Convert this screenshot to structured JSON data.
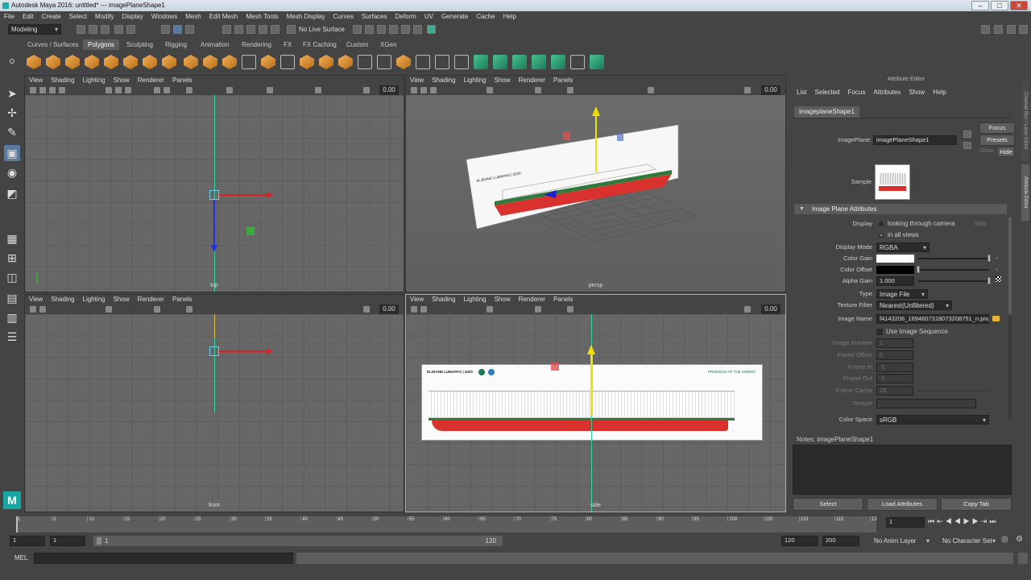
{
  "window": {
    "title": "Autodesk Maya 2016: untitled*   ---   imagePlaneShape1",
    "min": "–",
    "max": "□",
    "close": "✕"
  },
  "menubar": [
    "File",
    "Edit",
    "Create",
    "Select",
    "Modify",
    "Display",
    "Windows",
    "Mesh",
    "Edit Mesh",
    "Mesh Tools",
    "Mesh Display",
    "Curves",
    "Surfaces",
    "Deform",
    "UV",
    "Generate",
    "Cache",
    "Help"
  ],
  "statusline": {
    "menuset": "Modeling",
    "live_surface": "No Live Surface"
  },
  "shelf_tabs": [
    "Curves / Surfaces",
    "Polygons",
    "Sculpting",
    "Rigging",
    "Animation",
    "Rendering",
    "FX",
    "FX Caching",
    "Custom",
    "XGen"
  ],
  "shelf_active": "Polygons",
  "viewport_menu": [
    "View",
    "Shading",
    "Lighting",
    "Show",
    "Renderer",
    "Panels"
  ],
  "viewports": {
    "top": {
      "label": "top",
      "num": "0.00"
    },
    "persp": {
      "label": "persp",
      "num": "0.00"
    },
    "front": {
      "label": "front",
      "num": "0.00"
    },
    "side": {
      "label": "side",
      "num": "0.00"
    }
  },
  "image_plane_text": {
    "brand": "M.JEANE LUMAPAS | 2020",
    "ship_name": "PRINCESS OF THE ORIENT"
  },
  "attribute_editor": {
    "header": "Attribute Editor",
    "menu": [
      "List",
      "Selected",
      "Focus",
      "Attributes",
      "Show",
      "Help"
    ],
    "tab": "imageplaneShape1",
    "node_label": "imagePlane:",
    "node_value": "imagePlaneShape1",
    "focus": "Focus",
    "presets": "Presets",
    "show": "Show",
    "hide": "Hide",
    "sample_label": "Sample",
    "section": "Image Plane Attributes",
    "display_label": "Display",
    "display_opt1": "looking through camera",
    "display_opt1_extra": "side",
    "display_opt2": "in all views",
    "display_mode_label": "Display Mode",
    "display_mode": "RGBA",
    "color_gain_label": "Color Gain",
    "color_gain": "#ffffff",
    "color_offset_label": "Color Offset",
    "color_offset": "#000000",
    "alpha_gain_label": "Alpha Gain",
    "alpha_gain": "1.000",
    "type_label": "Type",
    "type": "Image File",
    "texture_filter_label": "Texture Filter",
    "texture_filter": "Nearest(Unfiltered)",
    "image_name_label": "Image Name",
    "image_name": "f4143206_1694607318073208751_n.png",
    "use_seq": "Use Image Sequence",
    "image_number_label": "Image Number",
    "image_number": "1",
    "frame_offset_label": "Frame Offset",
    "frame_offset": "0",
    "frame_in_label": "Frame In",
    "frame_in": "-1",
    "frame_out_label": "Frame Out",
    "frame_out": "-1",
    "frame_cache_label": "Frame Cache",
    "frame_cache": "25",
    "texture_label": "Texture",
    "color_space_label": "Color Space",
    "color_space": "sRGB",
    "notes": "Notes:  imagePlaneShape1",
    "btn_select": "Select",
    "btn_load": "Load Attributes",
    "btn_copy": "Copy Tab",
    "side_tabs": [
      "Channel Box / Layer Editor",
      "Attribute Editor"
    ]
  },
  "timeslider": {
    "ticks": [
      "1",
      "5",
      "10",
      "15",
      "20",
      "25",
      "30",
      "35",
      "40",
      "45",
      "50",
      "55",
      "60",
      "65",
      "70",
      "75",
      "80",
      "85",
      "90",
      "95",
      "100",
      "105",
      "110",
      "115",
      "12"
    ],
    "current": "1",
    "current_field": "1"
  },
  "range": {
    "start": "1",
    "start2": "1",
    "bar_start": "1",
    "bar_end": "120",
    "end": "120",
    "end2": "200",
    "anim_layer": "No Anim Layer",
    "char_set": "No Character Set"
  },
  "cmdline": {
    "label": "MEL"
  }
}
